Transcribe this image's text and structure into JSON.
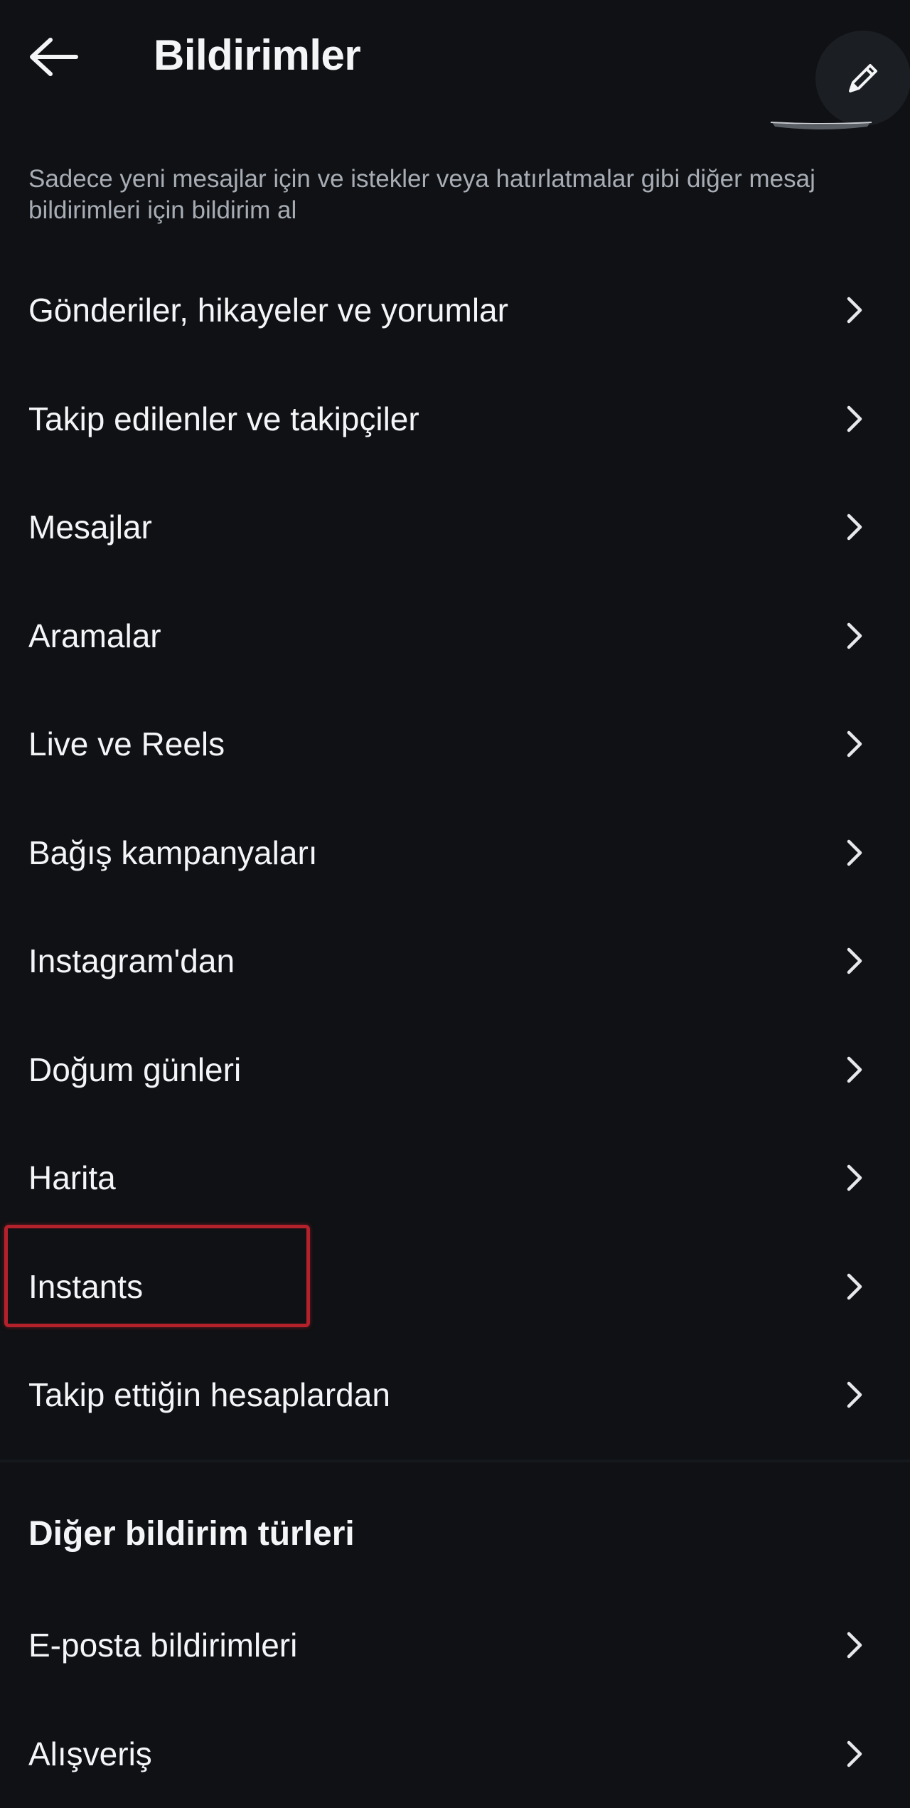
{
  "header": {
    "title": "Bildirimler",
    "back_icon": "arrow-left-icon",
    "compose_icon": "pencil-icon"
  },
  "description": "Sadece yeni mesajlar için ve istekler veya hatırlatmalar gibi diğer mesaj bildirimleri için bildirim al",
  "items": [
    {
      "label": "Gönderiler, hikayeler ve yorumlar"
    },
    {
      "label": "Takip edilenler ve takipçiler"
    },
    {
      "label": "Mesajlar"
    },
    {
      "label": "Aramalar"
    },
    {
      "label": "Live ve Reels"
    },
    {
      "label": "Bağış kampanyaları"
    },
    {
      "label": "Instagram'dan"
    },
    {
      "label": "Doğum günleri"
    },
    {
      "label": "Harita"
    },
    {
      "label": "Instants"
    },
    {
      "label": "Takip ettiğin hesaplardan"
    }
  ],
  "other_section": {
    "title": "Diğer bildirim türleri",
    "items": [
      {
        "label": "E-posta bildirimleri"
      },
      {
        "label": "Alışveriş"
      }
    ]
  },
  "highlighted_item": "Instants",
  "colors": {
    "background": "#0f1114",
    "text": "#f4f5f7",
    "secondary_text": "#a8adb5",
    "highlight": "#b3212b"
  }
}
